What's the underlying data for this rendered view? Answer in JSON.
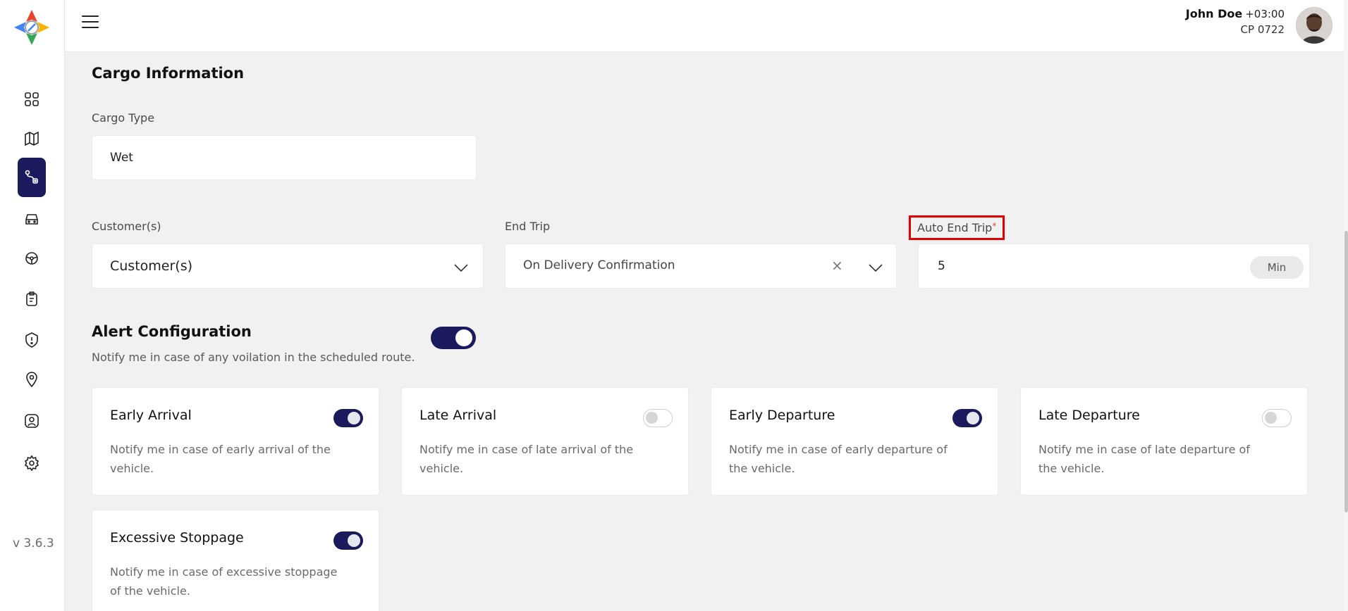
{
  "app": {
    "version": "v 3.6.3"
  },
  "sidebar": {
    "items": [
      {
        "icon": "dashboard-grid-icon"
      },
      {
        "icon": "map-icon"
      },
      {
        "icon": "route-icon",
        "active": true
      },
      {
        "icon": "car-icon"
      },
      {
        "icon": "steering-icon"
      },
      {
        "icon": "clipboard-icon"
      },
      {
        "icon": "alert-shield-icon"
      },
      {
        "icon": "location-pin-icon"
      },
      {
        "icon": "user-profile-icon"
      },
      {
        "icon": "settings-gear-icon"
      }
    ]
  },
  "header": {
    "user_name": "John Doe",
    "timezone": "+03:00",
    "user_code": "CP 0722"
  },
  "cargo": {
    "title": "Cargo Information",
    "type_label": "Cargo Type",
    "type_value": "Wet"
  },
  "customers": {
    "label": "Customer(s)",
    "value": "Customer(s)"
  },
  "end_trip": {
    "label": "End Trip",
    "value": "On Delivery Confirmation"
  },
  "auto_end_trip": {
    "label": "Auto End Trip",
    "required": "*",
    "value": "5",
    "unit": "Min"
  },
  "alert_config": {
    "title": "Alert Configuration",
    "description": "Notify me in case of any voilation in the scheduled route.",
    "enabled": true,
    "cards": [
      {
        "title": "Early Arrival",
        "description": "Notify me in case of early arrival of the vehicle.",
        "enabled": true
      },
      {
        "title": "Late Arrival",
        "description": "Notify me in case of late arrival of the vehicle.",
        "enabled": false
      },
      {
        "title": "Early Departure",
        "description": "Notify me in case of early departure of the vehicle.",
        "enabled": true
      },
      {
        "title": "Late Departure",
        "description": "Notify me in case of late departure of the vehicle.",
        "enabled": false
      },
      {
        "title": "Excessive Stoppage",
        "description": "Notify me in case of excessive stoppage of the vehicle.",
        "enabled": true
      }
    ]
  },
  "colors": {
    "accent": "#1b1a5c",
    "highlight": "#e00000",
    "background": "#f1f1f1"
  }
}
